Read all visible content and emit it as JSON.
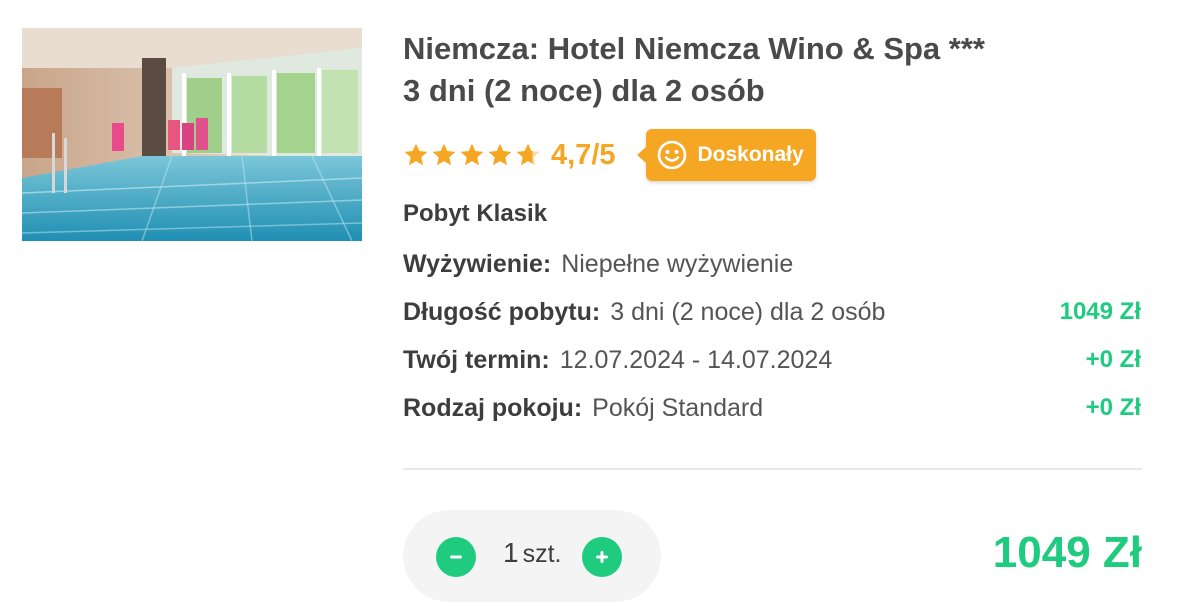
{
  "hotel": {
    "title_line1": "Niemcza: Hotel Niemcza Wino & Spa ***",
    "title_line2": "3 dni (2 noce) dla 2 osób",
    "rating_stars": 4.7,
    "rating_text": "4,7/5",
    "badge_label": "Doskonały",
    "badge_icon": "smiley-face-icon",
    "photo_subject": "indoor-pool-photo"
  },
  "package": {
    "name": "Pobyt Klasik",
    "meals_label": "Wyżywienie:",
    "meals_value": "Niepełne wyżywienie",
    "details": [
      {
        "label": "Długość pobytu:",
        "value": "3 dni (2 noce) dla 2 osób",
        "price": "1049 Zł"
      },
      {
        "label": "Twój termin:",
        "value": "12.07.2024 - 14.07.2024",
        "price": "+0 Zł"
      },
      {
        "label": "Rodzaj pokoju:",
        "value": "Pokój Standard",
        "price": "+0 Zł"
      }
    ]
  },
  "cart": {
    "quantity": "1",
    "unit": "szt.",
    "decrease_icon": "minus-icon",
    "increase_icon": "plus-icon",
    "total": "1049 Zł"
  },
  "colors": {
    "accent_green": "#1ecb7f",
    "rating_orange": "#f5a623",
    "text_dark": "#3d3d3d"
  }
}
